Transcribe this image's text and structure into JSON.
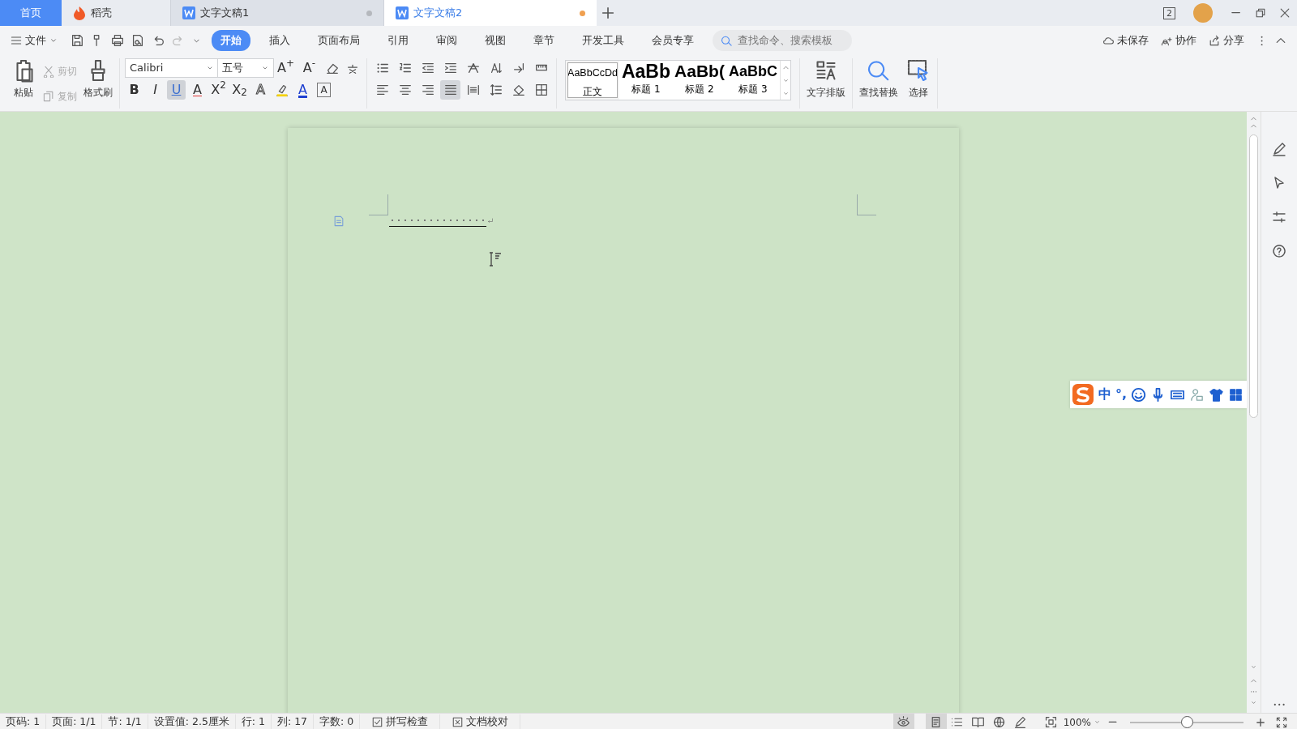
{
  "tabs": [
    {
      "label": "首页",
      "kind": "home",
      "selected": false
    },
    {
      "label": "稻壳",
      "kind": "docer",
      "selected": false
    },
    {
      "label": "文字文稿1",
      "kind": "doc",
      "selected": false,
      "modified": true
    },
    {
      "label": "文字文稿2",
      "kind": "doc",
      "selected": true,
      "modified": true
    }
  ],
  "window_count": "2",
  "menu": {
    "label": "文件"
  },
  "ribbon_tabs": [
    {
      "label": "开始",
      "selected": true
    },
    {
      "label": "插入",
      "selected": false
    },
    {
      "label": "页面布局",
      "selected": false
    },
    {
      "label": "引用",
      "selected": false
    },
    {
      "label": "审阅",
      "selected": false
    },
    {
      "label": "视图",
      "selected": false
    },
    {
      "label": "章节",
      "selected": false
    },
    {
      "label": "开发工具",
      "selected": false
    },
    {
      "label": "会员专享",
      "selected": false
    }
  ],
  "search": {
    "placeholder": "查找命令、搜索模板"
  },
  "top_actions": [
    {
      "label": "未保存",
      "kind": "cloud"
    },
    {
      "label": "协作",
      "kind": "collab"
    },
    {
      "label": "分享",
      "kind": "share"
    }
  ],
  "clipboard": [
    {
      "label": "粘贴",
      "kind": "paste",
      "disabled": false
    },
    {
      "label": "剪切",
      "kind": "cut",
      "disabled": true
    },
    {
      "label": "复制",
      "kind": "copy",
      "disabled": true
    },
    {
      "label": "格式刷",
      "kind": "brush",
      "disabled": false
    }
  ],
  "font": {
    "name": "Calibri",
    "size": "五号"
  },
  "font_size_buttons": [
    {
      "label": "A$^{+}$"
    },
    {
      "label": "A$^{-}$"
    }
  ],
  "format_buttons": [
    {
      "label": "B",
      "kind": "bold",
      "active": false
    },
    {
      "label": "I",
      "kind": "italic",
      "active": false
    },
    {
      "label": "U",
      "kind": "underline",
      "active": true
    },
    {
      "label": "A",
      "kind": "strike",
      "active": false
    },
    {
      "label": "X$^{2}$",
      "kind": "super",
      "active": false
    },
    {
      "label": "X$_{2}$",
      "kind": "sub",
      "active": false
    },
    {
      "label": "A",
      "kind": "effect",
      "active": false
    },
    {
      "kind": "highlight",
      "active": false
    },
    {
      "label": "A",
      "kind": "color",
      "active": false
    },
    {
      "label": "A",
      "kind": "charborder",
      "active": false
    }
  ],
  "paragraph_buttons": [
    {
      "kind": "bullets",
      "active": false
    },
    {
      "kind": "numbering",
      "active": false
    },
    {
      "kind": "outdent",
      "active": false
    },
    {
      "kind": "indent",
      "active": false
    },
    {
      "kind": "direction",
      "active": false
    },
    {
      "kind": "sort",
      "active": false
    },
    {
      "kind": "marks",
      "active": false
    },
    {
      "kind": "ruler",
      "active": false
    },
    {
      "kind": "left",
      "active": false
    },
    {
      "kind": "center",
      "active": false
    },
    {
      "kind": "right",
      "active": false
    },
    {
      "kind": "justify",
      "active": true
    },
    {
      "kind": "distribute",
      "active": false
    },
    {
      "kind": "spacing",
      "active": false
    },
    {
      "kind": "shading",
      "active": false
    },
    {
      "kind": "borders",
      "active": false
    }
  ],
  "styles": [
    {
      "preview": "AaBbCcDd",
      "label": "正文",
      "selected": true
    },
    {
      "preview": "AaBb",
      "label": "标题 1",
      "selected": false
    },
    {
      "preview": "AaBb(",
      "label": "标题 2",
      "selected": false
    },
    {
      "preview": "AaBbC",
      "label": "标题 3",
      "selected": false
    }
  ],
  "big_buttons": [
    {
      "label": "文字排版",
      "kind": "layout"
    },
    {
      "label": "查找替换",
      "kind": "find"
    },
    {
      "label": "选择",
      "kind": "select"
    }
  ],
  "status_items": [
    {
      "label": "页码: 1"
    },
    {
      "label": "页面: 1/1"
    },
    {
      "label": "节: 1/1"
    },
    {
      "label": "设置值: 2.5厘米"
    },
    {
      "label": "行: 1"
    },
    {
      "label": "列: 17"
    },
    {
      "label": "字数: 0"
    },
    {
      "label": "拼写检查",
      "kind": "check"
    },
    {
      "label": "文档校对",
      "kind": "proof"
    }
  ],
  "view_buttons": [
    {
      "kind": "eye",
      "selected": true
    },
    {
      "kind": "page",
      "selected": true
    },
    {
      "kind": "outline",
      "selected": false
    },
    {
      "kind": "read",
      "selected": false
    },
    {
      "kind": "web",
      "selected": false
    },
    {
      "kind": "pen",
      "selected": false
    }
  ],
  "zoom": {
    "label": "100%",
    "level": 0.5
  },
  "ime_bar": {
    "mode": "中",
    "punct": "°,"
  }
}
